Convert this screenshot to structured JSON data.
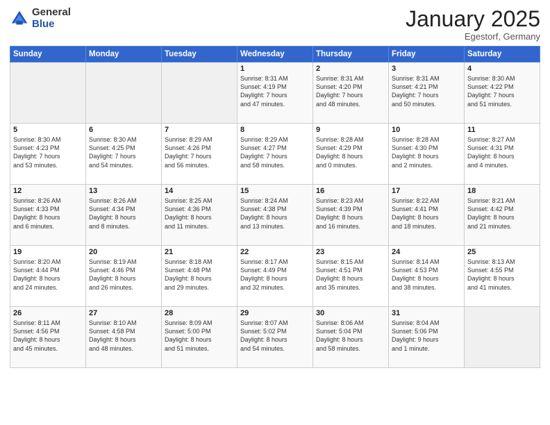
{
  "header": {
    "logo_general": "General",
    "logo_blue": "Blue",
    "month_title": "January 2025",
    "location": "Egestorf, Germany"
  },
  "weekdays": [
    "Sunday",
    "Monday",
    "Tuesday",
    "Wednesday",
    "Thursday",
    "Friday",
    "Saturday"
  ],
  "weeks": [
    [
      {
        "day": "",
        "info": ""
      },
      {
        "day": "",
        "info": ""
      },
      {
        "day": "",
        "info": ""
      },
      {
        "day": "1",
        "info": "Sunrise: 8:31 AM\nSunset: 4:19 PM\nDaylight: 7 hours\nand 47 minutes."
      },
      {
        "day": "2",
        "info": "Sunrise: 8:31 AM\nSunset: 4:20 PM\nDaylight: 7 hours\nand 48 minutes."
      },
      {
        "day": "3",
        "info": "Sunrise: 8:31 AM\nSunset: 4:21 PM\nDaylight: 7 hours\nand 50 minutes."
      },
      {
        "day": "4",
        "info": "Sunrise: 8:30 AM\nSunset: 4:22 PM\nDaylight: 7 hours\nand 51 minutes."
      }
    ],
    [
      {
        "day": "5",
        "info": "Sunrise: 8:30 AM\nSunset: 4:23 PM\nDaylight: 7 hours\nand 53 minutes."
      },
      {
        "day": "6",
        "info": "Sunrise: 8:30 AM\nSunset: 4:25 PM\nDaylight: 7 hours\nand 54 minutes."
      },
      {
        "day": "7",
        "info": "Sunrise: 8:29 AM\nSunset: 4:26 PM\nDaylight: 7 hours\nand 56 minutes."
      },
      {
        "day": "8",
        "info": "Sunrise: 8:29 AM\nSunset: 4:27 PM\nDaylight: 7 hours\nand 58 minutes."
      },
      {
        "day": "9",
        "info": "Sunrise: 8:28 AM\nSunset: 4:29 PM\nDaylight: 8 hours\nand 0 minutes."
      },
      {
        "day": "10",
        "info": "Sunrise: 8:28 AM\nSunset: 4:30 PM\nDaylight: 8 hours\nand 2 minutes."
      },
      {
        "day": "11",
        "info": "Sunrise: 8:27 AM\nSunset: 4:31 PM\nDaylight: 8 hours\nand 4 minutes."
      }
    ],
    [
      {
        "day": "12",
        "info": "Sunrise: 8:26 AM\nSunset: 4:33 PM\nDaylight: 8 hours\nand 6 minutes."
      },
      {
        "day": "13",
        "info": "Sunrise: 8:26 AM\nSunset: 4:34 PM\nDaylight: 8 hours\nand 8 minutes."
      },
      {
        "day": "14",
        "info": "Sunrise: 8:25 AM\nSunset: 4:36 PM\nDaylight: 8 hours\nand 11 minutes."
      },
      {
        "day": "15",
        "info": "Sunrise: 8:24 AM\nSunset: 4:38 PM\nDaylight: 8 hours\nand 13 minutes."
      },
      {
        "day": "16",
        "info": "Sunrise: 8:23 AM\nSunset: 4:39 PM\nDaylight: 8 hours\nand 16 minutes."
      },
      {
        "day": "17",
        "info": "Sunrise: 8:22 AM\nSunset: 4:41 PM\nDaylight: 8 hours\nand 18 minutes."
      },
      {
        "day": "18",
        "info": "Sunrise: 8:21 AM\nSunset: 4:42 PM\nDaylight: 8 hours\nand 21 minutes."
      }
    ],
    [
      {
        "day": "19",
        "info": "Sunrise: 8:20 AM\nSunset: 4:44 PM\nDaylight: 8 hours\nand 24 minutes."
      },
      {
        "day": "20",
        "info": "Sunrise: 8:19 AM\nSunset: 4:46 PM\nDaylight: 8 hours\nand 26 minutes."
      },
      {
        "day": "21",
        "info": "Sunrise: 8:18 AM\nSunset: 4:48 PM\nDaylight: 8 hours\nand 29 minutes."
      },
      {
        "day": "22",
        "info": "Sunrise: 8:17 AM\nSunset: 4:49 PM\nDaylight: 8 hours\nand 32 minutes."
      },
      {
        "day": "23",
        "info": "Sunrise: 8:15 AM\nSunset: 4:51 PM\nDaylight: 8 hours\nand 35 minutes."
      },
      {
        "day": "24",
        "info": "Sunrise: 8:14 AM\nSunset: 4:53 PM\nDaylight: 8 hours\nand 38 minutes."
      },
      {
        "day": "25",
        "info": "Sunrise: 8:13 AM\nSunset: 4:55 PM\nDaylight: 8 hours\nand 41 minutes."
      }
    ],
    [
      {
        "day": "26",
        "info": "Sunrise: 8:11 AM\nSunset: 4:56 PM\nDaylight: 8 hours\nand 45 minutes."
      },
      {
        "day": "27",
        "info": "Sunrise: 8:10 AM\nSunset: 4:58 PM\nDaylight: 8 hours\nand 48 minutes."
      },
      {
        "day": "28",
        "info": "Sunrise: 8:09 AM\nSunset: 5:00 PM\nDaylight: 8 hours\nand 51 minutes."
      },
      {
        "day": "29",
        "info": "Sunrise: 8:07 AM\nSunset: 5:02 PM\nDaylight: 8 hours\nand 54 minutes."
      },
      {
        "day": "30",
        "info": "Sunrise: 8:06 AM\nSunset: 5:04 PM\nDaylight: 8 hours\nand 58 minutes."
      },
      {
        "day": "31",
        "info": "Sunrise: 8:04 AM\nSunset: 5:06 PM\nDaylight: 9 hours\nand 1 minute."
      },
      {
        "day": "",
        "info": ""
      }
    ]
  ]
}
